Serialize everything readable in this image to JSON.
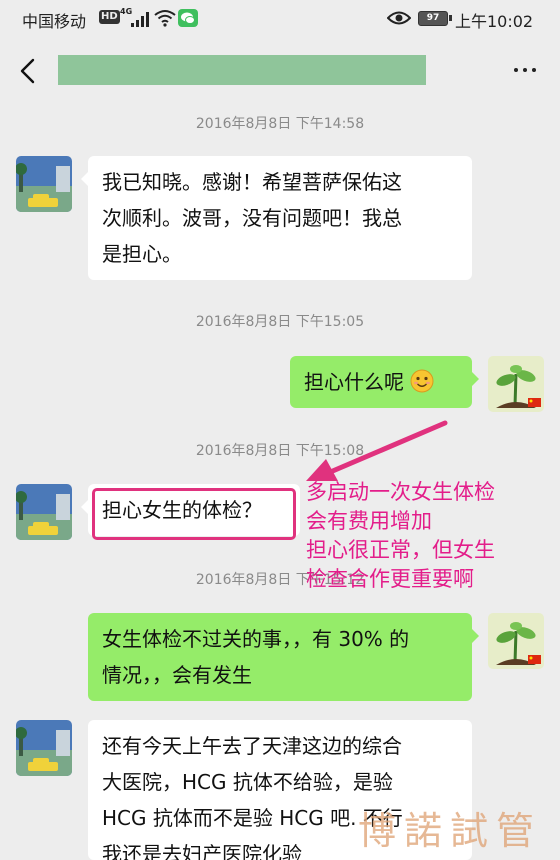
{
  "status_bar": {
    "carrier": "中国移动",
    "hd_badge": "HD",
    "network": "4G",
    "battery": "97",
    "time": "上午10:02"
  },
  "header": {
    "back_icon": "chevron-left-icon",
    "more_icon": "more-dots-icon"
  },
  "messages": [
    {
      "kind": "time",
      "text": "2016年8月8日 下午14:58"
    },
    {
      "kind": "bubble",
      "side": "left",
      "lines": [
        "我已知晓。感谢！希望菩萨保佑这",
        "次顺利。波哥，没有问题吧！我总",
        "是担心。"
      ]
    },
    {
      "kind": "time",
      "text": "2016年8月8日 下午15:05"
    },
    {
      "kind": "bubble",
      "side": "right",
      "lines": [
        "担心什么呢"
      ],
      "emoji": "smile-emoji-icon"
    },
    {
      "kind": "time",
      "text": "2016年8月8日 下午15:08"
    },
    {
      "kind": "bubble",
      "side": "left",
      "lines": [
        "担心女生的体检？"
      ],
      "highlighted": true
    },
    {
      "kind": "time",
      "text": "2016年8月8日 下午15:12"
    },
    {
      "kind": "bubble",
      "side": "right",
      "lines": [
        "女生体检不过关的事，，有 30% 的",
        "情况，，会有发生"
      ]
    },
    {
      "kind": "bubble",
      "side": "left",
      "lines": [
        "还有今天上午去了天津这边的综合",
        "大医院，HCG 抗体不给验，是验",
        "HCG 抗体而不是验 HCG 吧. 不行",
        "我还是去妇产医院化验"
      ]
    }
  ],
  "annotation": {
    "lines": [
      "多启动一次女生体检",
      "会有费用增加",
      "担心很正常，但女生",
      "检查合作更重要啊"
    ],
    "color": "#e31d8a"
  },
  "watermark": "博諾試管",
  "colors": {
    "background": "#ededed",
    "bubble_sent": "#95ec69",
    "bubble_received": "#ffffff",
    "title_mask": "#8fc59a",
    "highlight": "#e0327e"
  }
}
